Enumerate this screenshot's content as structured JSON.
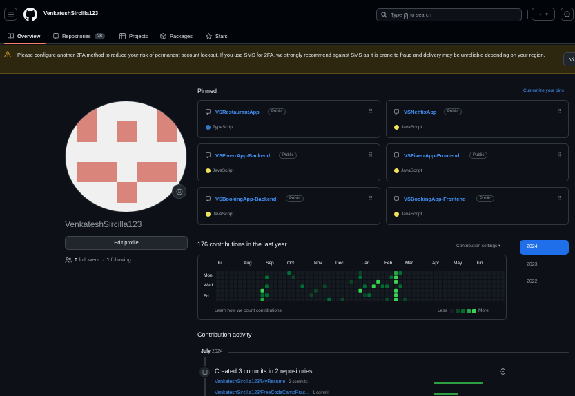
{
  "header": {
    "username": "VenkateshSircilla123",
    "search_text_before": "Type",
    "search_key": "/",
    "search_text_after": "to search",
    "add_plus": "+",
    "add_caret": "▾"
  },
  "tabs": [
    {
      "label": "Overview",
      "icon": "book-icon",
      "active": true
    },
    {
      "label": "Repositories",
      "icon": "repo-icon",
      "count": "28"
    },
    {
      "label": "Projects",
      "icon": "table-icon"
    },
    {
      "label": "Packages",
      "icon": "package-icon"
    },
    {
      "label": "Stars",
      "icon": "star-icon"
    }
  ],
  "banner": {
    "text": "Please configure another 2FA method to reduce your risk of permanent account lockout. If you use SMS for 2FA, we strongly recommend against SMS as it is prone to fraud and delivery may be unreliable depending on your region.",
    "button": "Vi",
    "color": "#d29922"
  },
  "profile": {
    "name": "VenkateshSircilla123",
    "edit_button": "Edit profile",
    "followers_count": "0",
    "followers_label": "followers",
    "separator": "·",
    "following_count": "1",
    "following_label": "following"
  },
  "pinned": {
    "title": "Pinned",
    "customize": "Customize your pins",
    "repos": [
      {
        "name": "VSRestaurantApp",
        "visibility": "Public",
        "language": "TypeScript",
        "lang_color": "#3178c6"
      },
      {
        "name": "VSNetflixApp",
        "visibility": "Public",
        "language": "JavaScript",
        "lang_color": "#f1e05a"
      },
      {
        "name": "VSFiverrApp-Backend",
        "visibility": "Public",
        "language": "JavaScript",
        "lang_color": "#f1e05a"
      },
      {
        "name": "VSFiverrApp-Frontend",
        "visibility": "Public",
        "language": "JavaScript",
        "lang_color": "#f1e05a"
      },
      {
        "name": "VSBookingApp-Backend",
        "visibility": "Public",
        "language": "JavaScript",
        "lang_color": "#f1e05a"
      },
      {
        "name": "VSBookingApp-Frontend",
        "visibility": "Public",
        "language": "JavaScript",
        "lang_color": "#f1e05a"
      }
    ]
  },
  "contributions": {
    "summary": "176 contributions in the last year",
    "settings": "Contribution settings ▾",
    "months": [
      "Jul",
      "Aug",
      "Sep",
      "Oct",
      "Nov",
      "Dec",
      "Jan",
      "Feb",
      "Mar",
      "Apr",
      "May",
      "Jun"
    ],
    "weekdays": [
      "Mon",
      "Wed",
      "Fri"
    ],
    "learn": "Learn how we count contributions",
    "less": "Less",
    "more": "More",
    "level_colors": [
      "#161b22",
      "#0e4429",
      "#006d32",
      "#26a641",
      "#39d353"
    ],
    "cells": [
      [
        10,
        4,
        4
      ],
      [
        10,
        5,
        2
      ],
      [
        10,
        6,
        3
      ],
      [
        10,
        7,
        4
      ],
      [
        11,
        1,
        2
      ],
      [
        11,
        3,
        2
      ],
      [
        11,
        5,
        2
      ],
      [
        19,
        3,
        2
      ],
      [
        21,
        5,
        1
      ],
      [
        21,
        8,
        1
      ],
      [
        22,
        4,
        1
      ],
      [
        24,
        3,
        1
      ],
      [
        25,
        6,
        2
      ],
      [
        32,
        0,
        1
      ],
      [
        32,
        1,
        2
      ],
      [
        32,
        4,
        4
      ],
      [
        33,
        3,
        2
      ],
      [
        33,
        5,
        1
      ],
      [
        34,
        5,
        2
      ],
      [
        35,
        3,
        4
      ],
      [
        36,
        2,
        4
      ],
      [
        37,
        3,
        2
      ],
      [
        38,
        3,
        2
      ],
      [
        38,
        6,
        1
      ],
      [
        39,
        1,
        2
      ],
      [
        40,
        0,
        3
      ],
      [
        40,
        1,
        4
      ],
      [
        40,
        2,
        4
      ],
      [
        40,
        4,
        4
      ],
      [
        40,
        5,
        4
      ],
      [
        40,
        6,
        4
      ],
      [
        41,
        0,
        2
      ],
      [
        41,
        3,
        2
      ],
      [
        41,
        7,
        3
      ],
      [
        42,
        6,
        1
      ],
      [
        16,
        0,
        2
      ],
      [
        17,
        1,
        1
      ],
      [
        30,
        2,
        1
      ],
      [
        28,
        6,
        1
      ]
    ]
  },
  "years": [
    "2024",
    "2023",
    "2022"
  ],
  "activity": {
    "title": "Contribution activity",
    "month": "July",
    "year": "2024",
    "event": "Created 3 commits in 2 repositories",
    "repos": [
      {
        "name": "VenkateshSircilla123/MyResume",
        "commits": "2 commits",
        "fraction": 1.0
      },
      {
        "name": "VenkateshSircilla123/FreeCodeCampPrac...",
        "commits": "1 commit",
        "fraction": 0.5
      }
    ]
  }
}
